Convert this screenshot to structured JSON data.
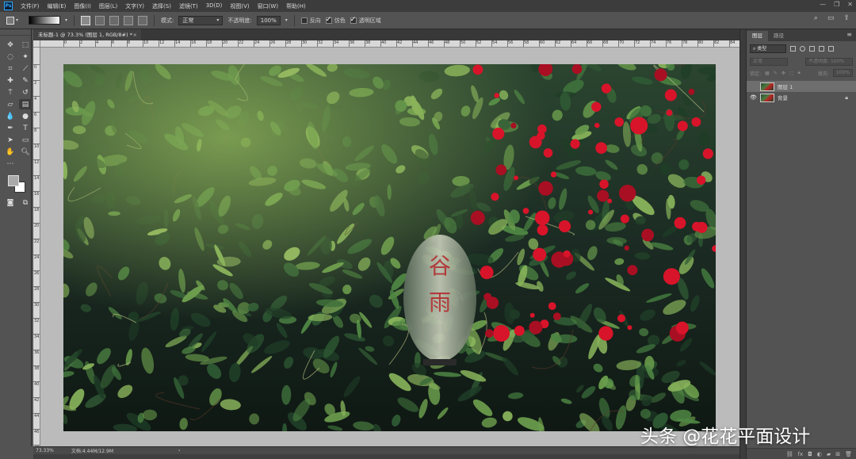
{
  "menubar": {
    "items": [
      "文件(F)",
      "编辑(E)",
      "图像(I)",
      "图层(L)",
      "文字(Y)",
      "选择(S)",
      "滤镜(T)",
      "3D(D)",
      "视图(V)",
      "窗口(W)",
      "帮助(H)"
    ]
  },
  "options": {
    "mode_label": "模式:",
    "mode_value": "正常",
    "opacity_label": "不透明度:",
    "opacity_value": "100%",
    "reverse_label": "反向",
    "reverse_checked": false,
    "dither_label": "仿色",
    "dither_checked": true,
    "transparency_label": "透明区域",
    "transparency_checked": true
  },
  "document": {
    "tab_title": "未标题-1 @ 73.3% (图层 1, RGB/8#) *",
    "close_symbol": "×"
  },
  "status": {
    "zoom": "73.33%",
    "doc_info": "文档:4.44M/12.9M"
  },
  "layers_panel": {
    "tabs": [
      "图层",
      "路径"
    ],
    "filter_label": "类型",
    "blend_mode": "正常",
    "opacity_label": "不透明度:",
    "opacity_value": "100%",
    "lock_label": "锁定:",
    "fill_label": "填充:",
    "fill_value": "100%",
    "layers": [
      {
        "name": "图层 1",
        "visible": false,
        "selected": true,
        "locked": false
      },
      {
        "name": "背景",
        "visible": true,
        "selected": false,
        "locked": true
      }
    ]
  },
  "watermark": "头条 @花花平面设计",
  "photo": {
    "lantern_text": "谷雨"
  },
  "colors": {
    "foreground": "#aaaaaa",
    "background": "#ffffff",
    "accent": "#31a8ff"
  }
}
